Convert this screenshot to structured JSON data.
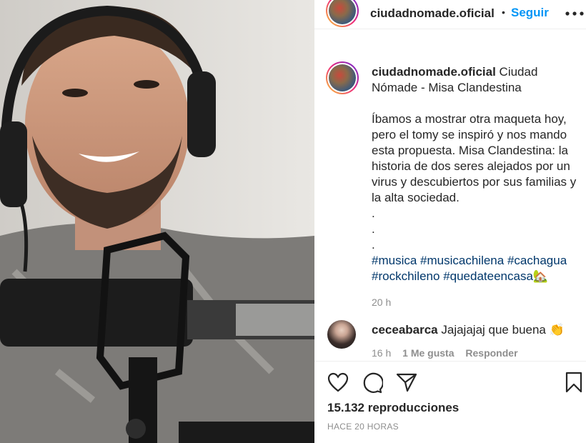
{
  "post": {
    "username": "ciudadnomade.oficial",
    "separator": "•",
    "follow_label": "Seguir",
    "more_icon": "more-horizontal-icon",
    "caption_title": "Ciudad Nómade - Misa Clandestina",
    "caption_body": "Íbamos a mostrar otra maqueta hoy, pero el tomy se inspiró y nos mando esta propuesta. Misa Clandestina: la historia de dos seres alejados por un virus y descubiertos por sus familias y la alta sociedad.",
    "dots": [
      ".",
      ".",
      "."
    ],
    "hashtags": [
      "#musica",
      "#musicachilena",
      "#cachagua",
      "#rockchileno",
      "#quedateencasa"
    ],
    "hashtag_emoji": "🏡",
    "caption_time": "20 h"
  },
  "comment": {
    "username": "ceceabarca",
    "text": "Jajajajaj que buena",
    "emoji": "👏",
    "time": "16 h",
    "likes": "1 Me gusta",
    "reply": "Responder"
  },
  "stats": {
    "views": "15.132 reproducciones",
    "posted": "HACE 20 HORAS"
  },
  "colors": {
    "follow": "#0095f6",
    "hashtag": "#00376b",
    "muted": "#8e8e8e",
    "text": "#262626"
  }
}
